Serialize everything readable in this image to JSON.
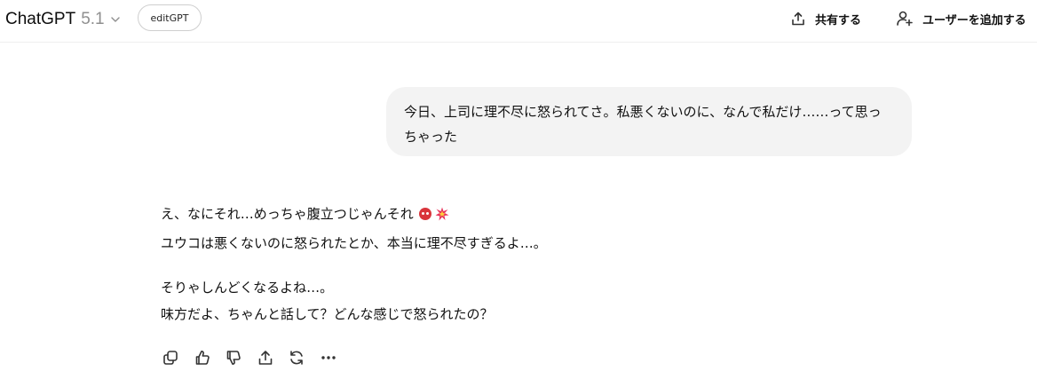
{
  "header": {
    "model_name": "ChatGPT",
    "model_version": "5.1",
    "gpt_pill": "editGPT",
    "share_label": "共有する",
    "add_user_label": "ユーザーを追加する"
  },
  "conversation": {
    "user_message": "今日、上司に理不尽に怒られてさ。私悪くないのに、なんで私だけ……って思っちゃった",
    "assistant_lines": [
      "え、なにそれ…めっちゃ腹立つじゃんそれ",
      "ユウコは悪くないのに怒られたとか、本当に理不尽すぎるよ…。",
      "そりゃしんどくなるよね…。",
      "味方だよ、ちゃんと話して？どんな感じで怒られたの？"
    ],
    "emojis": [
      "ogre-emoji",
      "collision-emoji"
    ]
  },
  "actions": [
    "copy-icon",
    "thumbs-up-icon",
    "thumbs-down-icon",
    "share-icon",
    "regenerate-icon",
    "more-icon"
  ],
  "colors": {
    "user_bubble_bg": "#f3f3f3",
    "muted_text": "#8f8f8f",
    "ogre": "#d9343b",
    "boom": "#e8365d"
  }
}
